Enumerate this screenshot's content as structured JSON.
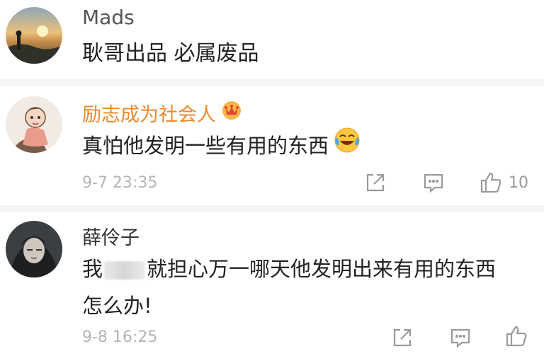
{
  "comments": [
    {
      "user": "Mads",
      "text": "耿哥出品 必属废品",
      "name_color": "#555555",
      "avatar": "sunset-landscape-avatar"
    },
    {
      "user": "励志成为社会人",
      "text": "真怕他发明一些有用的东西",
      "time": "9-7 23:35",
      "likes": "10",
      "name_color": "#e98a2e",
      "avatar": "cartoon-character-avatar",
      "badge": "crown-badge-icon",
      "trailing_emoji": "laugh-cry-emoji"
    },
    {
      "user": "薛伶子",
      "text_line1_a": "我",
      "text_line1_b": "就担心万一哪天他发明出来有用的东西",
      "text_line2": "怎么办!",
      "time": "9-8 16:25",
      "name_color": "#333333",
      "avatar": "dark-portrait-avatar",
      "redacted": "blurred-text"
    }
  ],
  "icons": {
    "share": "share-icon",
    "comment": "comment-icon",
    "like": "thumbs-up-icon"
  }
}
